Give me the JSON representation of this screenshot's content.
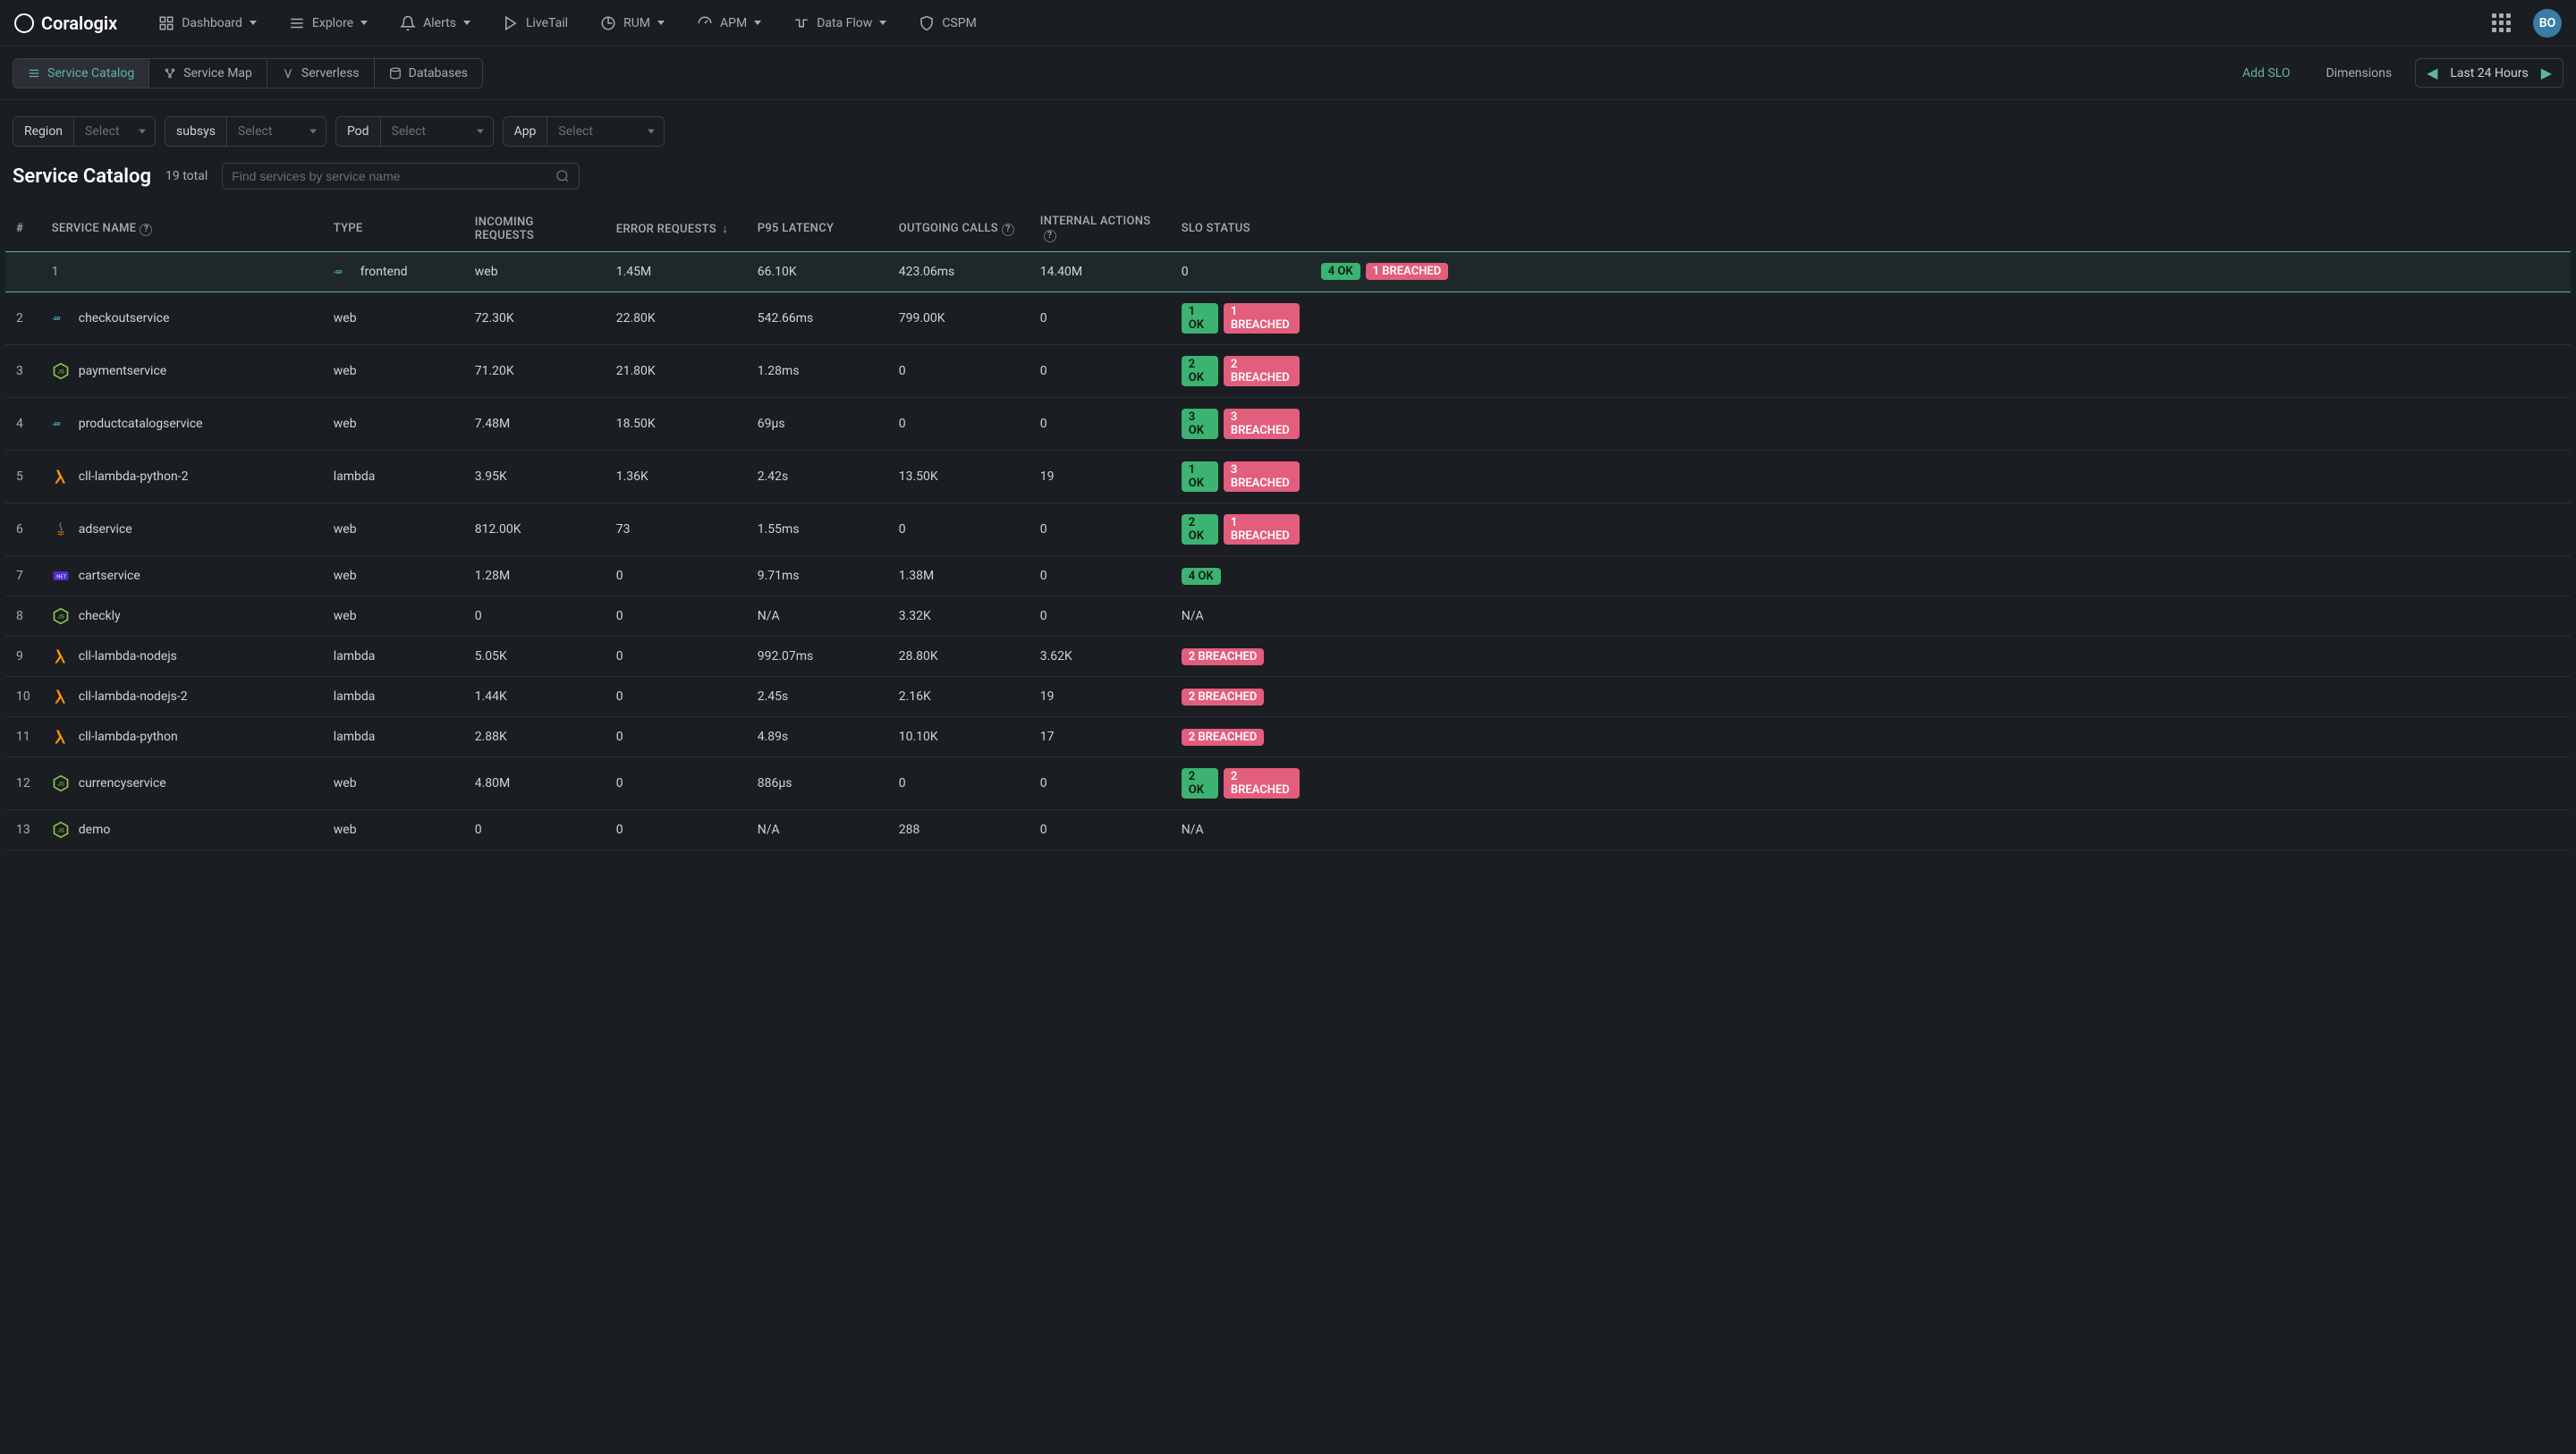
{
  "brand": "Coralogix",
  "topnav": {
    "items": [
      "Dashboard",
      "Explore",
      "Alerts",
      "LiveTail",
      "RUM",
      "APM",
      "Data Flow",
      "CSPM"
    ]
  },
  "avatar_initials": "BO",
  "subtabs": [
    "Service Catalog",
    "Service Map",
    "Serverless",
    "Databases"
  ],
  "subtabs_active": 0,
  "toolbar": {
    "add_slo": "Add SLO",
    "dimensions": "Dimensions",
    "time_range": "Last 24 Hours"
  },
  "filters": [
    {
      "label": "Region",
      "placeholder": "Select"
    },
    {
      "label": "subsys",
      "placeholder": "Select"
    },
    {
      "label": "Pod",
      "placeholder": "Select"
    },
    {
      "label": "App",
      "placeholder": "Select"
    }
  ],
  "page_title": "Service Catalog",
  "total_label": "19 total",
  "search_placeholder": "Find services by service name",
  "columns": {
    "idx": "#",
    "name": "SERVICE NAME",
    "type": "TYPE",
    "incoming": "INCOMING REQUESTS",
    "error": "ERROR REQUESTS",
    "p95": "P95 LATENCY",
    "outgoing": "OUTGOING CALLS",
    "internal": "INTERNAL ACTIONS",
    "slo": "SLO STATUS"
  },
  "rows": [
    {
      "n": "1",
      "name": "frontend",
      "tech": "go",
      "type": "web",
      "inc": "1.45M",
      "err": "66.10K",
      "p95": "423.06ms",
      "out": "14.40M",
      "int": "0",
      "ok": "4 OK",
      "breach": "1 BREACHED",
      "selected": true
    },
    {
      "n": "2",
      "name": "checkoutservice",
      "tech": "go",
      "type": "web",
      "inc": "72.30K",
      "err": "22.80K",
      "p95": "542.66ms",
      "out": "799.00K",
      "int": "0",
      "ok": "1 OK",
      "breach": "1 BREACHED"
    },
    {
      "n": "3",
      "name": "paymentservice",
      "tech": "node",
      "type": "web",
      "inc": "71.20K",
      "err": "21.80K",
      "p95": "1.28ms",
      "out": "0",
      "int": "0",
      "ok": "2 OK",
      "breach": "2 BREACHED"
    },
    {
      "n": "4",
      "name": "productcatalogservice",
      "tech": "go",
      "type": "web",
      "inc": "7.48M",
      "err": "18.50K",
      "p95": "69µs",
      "out": "0",
      "int": "0",
      "ok": "3 OK",
      "breach": "3 BREACHED"
    },
    {
      "n": "5",
      "name": "cll-lambda-python-2",
      "tech": "lambda",
      "type": "lambda",
      "inc": "3.95K",
      "err": "1.36K",
      "p95": "2.42s",
      "out": "13.50K",
      "int": "19",
      "ok": "1 OK",
      "breach": "3 BREACHED"
    },
    {
      "n": "6",
      "name": "adservice",
      "tech": "java",
      "type": "web",
      "inc": "812.00K",
      "err": "73",
      "p95": "1.55ms",
      "out": "0",
      "int": "0",
      "ok": "2 OK",
      "breach": "1 BREACHED"
    },
    {
      "n": "7",
      "name": "cartservice",
      "tech": "dotnet",
      "type": "web",
      "inc": "1.28M",
      "err": "0",
      "p95": "9.71ms",
      "out": "1.38M",
      "int": "0",
      "ok": "4 OK",
      "breach": null
    },
    {
      "n": "8",
      "name": "checkly",
      "tech": "node",
      "type": "web",
      "inc": "0",
      "err": "0",
      "p95": "N/A",
      "out": "3.32K",
      "int": "0",
      "ok": null,
      "breach": null,
      "slo_na": "N/A"
    },
    {
      "n": "9",
      "name": "cll-lambda-nodejs",
      "tech": "lambda",
      "type": "lambda",
      "inc": "5.05K",
      "err": "0",
      "p95": "992.07ms",
      "out": "28.80K",
      "int": "3.62K",
      "ok": null,
      "breach": "2 BREACHED"
    },
    {
      "n": "10",
      "name": "cll-lambda-nodejs-2",
      "tech": "lambda",
      "type": "lambda",
      "inc": "1.44K",
      "err": "0",
      "p95": "2.45s",
      "out": "2.16K",
      "int": "19",
      "ok": null,
      "breach": "2 BREACHED"
    },
    {
      "n": "11",
      "name": "cll-lambda-python",
      "tech": "lambda",
      "type": "lambda",
      "inc": "2.88K",
      "err": "0",
      "p95": "4.89s",
      "out": "10.10K",
      "int": "17",
      "ok": null,
      "breach": "2 BREACHED"
    },
    {
      "n": "12",
      "name": "currencyservice",
      "tech": "node",
      "type": "web",
      "inc": "4.80M",
      "err": "0",
      "p95": "886µs",
      "out": "0",
      "int": "0",
      "ok": "2 OK",
      "breach": "2 BREACHED"
    },
    {
      "n": "13",
      "name": "demo",
      "tech": "node",
      "type": "web",
      "inc": "0",
      "err": "0",
      "p95": "N/A",
      "out": "288",
      "int": "0",
      "ok": null,
      "breach": null,
      "slo_na": "N/A"
    }
  ]
}
